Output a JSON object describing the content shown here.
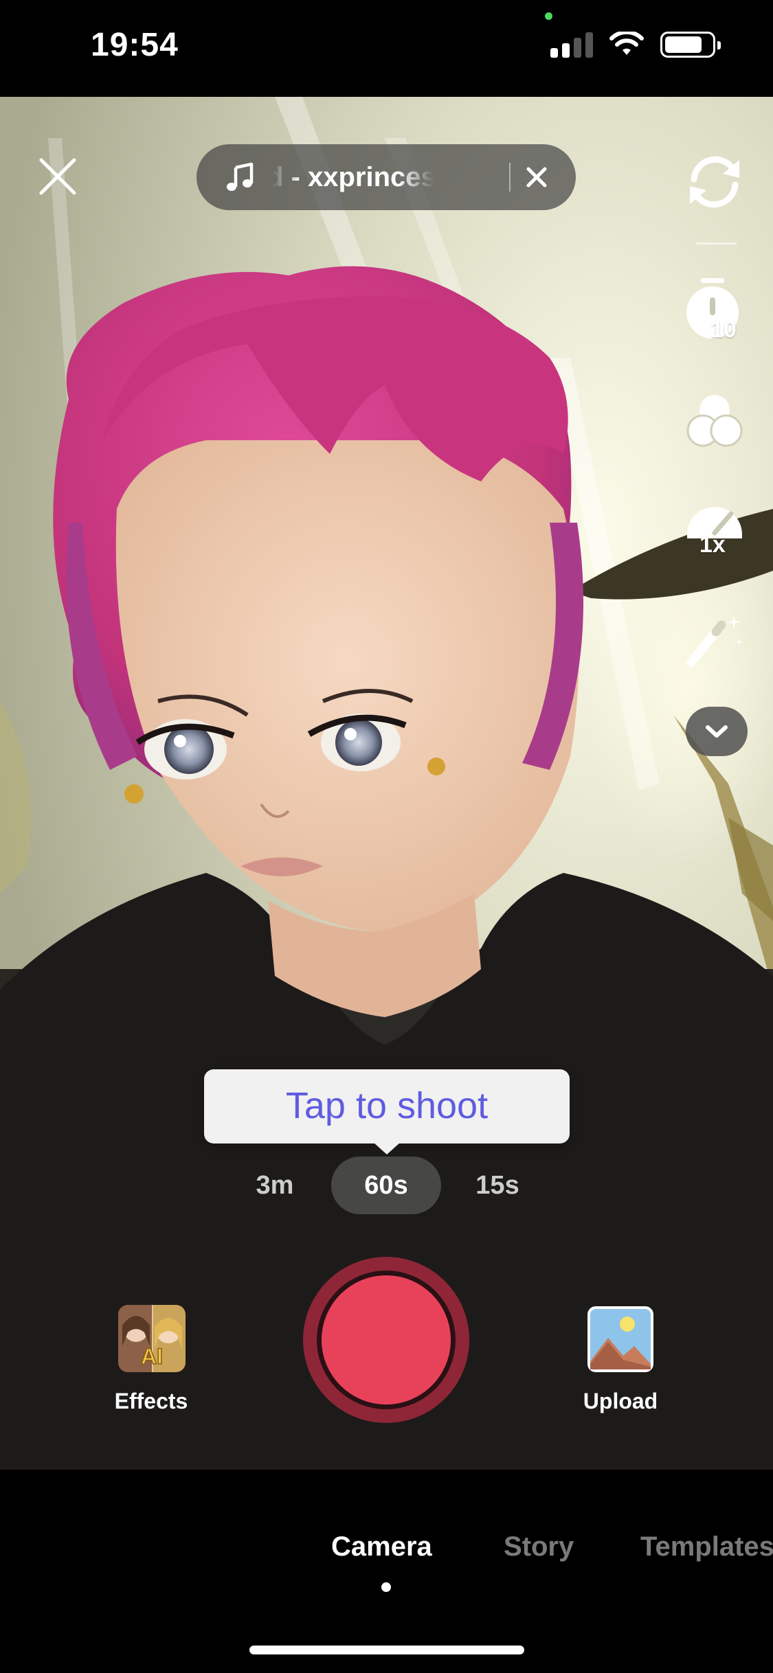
{
  "status_bar": {
    "time": "19:54",
    "signal_bars_filled": 2,
    "signal_bars_total": 4,
    "wifi_icon": "wifi-icon",
    "battery_level": 0.8
  },
  "top_bar": {
    "close_icon": "close-icon",
    "sound_label": "d - xxprincess.dia",
    "note_icon": "music-note-icon",
    "remove_sound_icon": "close-icon"
  },
  "side_tools": [
    {
      "id": "flip",
      "icon": "flip-camera-icon"
    },
    {
      "id": "timer",
      "icon": "timer-icon",
      "badge": "10"
    },
    {
      "id": "filters",
      "icon": "filters-icon"
    },
    {
      "id": "speed",
      "icon": "speed-icon",
      "badge": "1x"
    },
    {
      "id": "beauty",
      "icon": "magic-wand-icon"
    },
    {
      "id": "more",
      "icon": "chevron-down-icon"
    }
  ],
  "tooltip": {
    "text": "Tap to shoot"
  },
  "durations": [
    {
      "label": "3m",
      "selected": false
    },
    {
      "label": "60s",
      "selected": true
    },
    {
      "label": "15s",
      "selected": false
    }
  ],
  "bottom_controls": {
    "effects_label": "Effects",
    "effects_badge": "AI",
    "upload_label": "Upload",
    "record_color": "#e8425a"
  },
  "mode_tabs": [
    {
      "label": "Camera",
      "active": true
    },
    {
      "label": "Story",
      "active": false
    },
    {
      "label": "Templates",
      "active": false
    }
  ],
  "colors": {
    "accent_red": "#e8425a",
    "tooltip_text": "#5f5ce0",
    "hair_pink": "#d23a86"
  }
}
